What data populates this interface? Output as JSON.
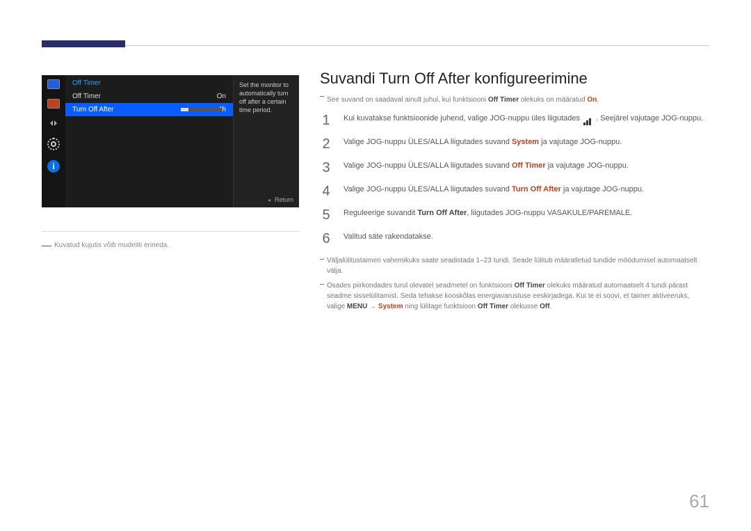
{
  "page_number": "61",
  "osd": {
    "title": "Off Timer",
    "row_offtimer": {
      "label": "Off Timer",
      "value": "On"
    },
    "row_turnoff": {
      "label": "Turn Off After",
      "value": "4h"
    },
    "side_hint": "Set the monitor to automatically turn off after a certain time period.",
    "footer": "Return"
  },
  "fig_note": "Kuvatud kujutis võib mudeliti erineda.",
  "h1": "Suvandi Turn Off After konfigureerimine",
  "pre_note": {
    "p1": "See suvand on saadaval ainult juhul, kui funktsiooni ",
    "b1": "Off Timer",
    "p2": " olekuks on määratud ",
    "a1": "On",
    "p3": "."
  },
  "steps": {
    "s1a": "Kui kuvatakse funktsioonide juhend, valige JOG-nuppu üles liigutades ",
    "s1b": ". Seejärel vajutage JOG-nuppu.",
    "s2a": "Valige JOG-nuppu ÜLES/ALLA liigutades suvand ",
    "s2b": "System",
    "s2c": " ja vajutage JOG-nuppu.",
    "s3a": "Valige JOG-nuppu ÜLES/ALLA liigutades suvand ",
    "s3b": "Off Timer",
    "s3c": " ja vajutage JOG-nuppu.",
    "s4a": "Valige JOG-nuppu ÜLES/ALLA liigutades suvand ",
    "s4b": "Turn Off After",
    "s4c": " ja vajutage JOG-nuppu.",
    "s5a": "Reguleerige suvandit ",
    "s5b": "Turn Off After",
    "s5c": ", liigutades JOG-nuppu VASAKULE/PAREMALE.",
    "s6": "Valitud säte rakendatakse."
  },
  "post": {
    "n1": "Väljalülitustaimeri vahemikuks saate seadistada 1–23 tundi. Seade lülitub määratletud tundide möödumisel automaatselt välja.",
    "n2a": "Osades piirkondades turul olevatel seadmetel on funktsiooni ",
    "n2b": "Off Timer",
    "n2c": " olekuks määratud automaatselt 4 tundi pärast seadme sisselülitamist. Seda tehakse kooskõlas energiavarustuse eeskirjadega. Kui te ei soovi, et taimer aktiveeruks, valige ",
    "menu": "MENU",
    "arrow": " → ",
    "system": "System",
    "n2d": " ning lülitage funktsioon ",
    "n2e": "Off Timer",
    "n2f": " olekusse ",
    "off": "Off",
    "dot": "."
  }
}
